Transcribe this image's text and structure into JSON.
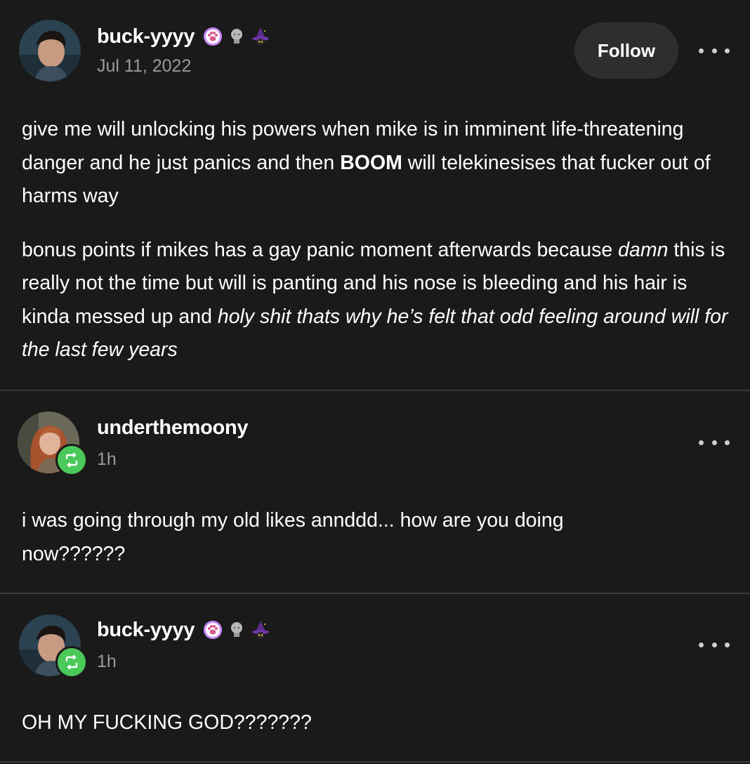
{
  "posts": [
    {
      "username": "buck-yyyy",
      "timestamp": "Jul 11, 2022",
      "follow_label": "Follow",
      "badges": [
        "paw-badge-icon",
        "statue-badge-icon",
        "witch-hat-badge-icon"
      ],
      "paragraphs": [
        {
          "a": "give me will unlocking his powers when mike is in imminent life-threatening danger and he just panics and then ",
          "b_bold": "BOOM",
          "c": " will telekinesises that fucker out of harms way"
        },
        {
          "a_italic": "damn",
          "pre": "bonus points if mikes has a gay panic moment afterwards because ",
          "mid": " this is really not the time but will is panting and his nose is bleeding and his hair is kinda messed up and ",
          "end_italic": "holy shit thats why he’s felt that odd feeling around will for the last few years"
        }
      ]
    },
    {
      "username": "underthemoony",
      "timestamp": "1h",
      "text": "i was going through my old likes annddd... how are you doing now??????"
    },
    {
      "username": "buck-yyyy",
      "timestamp": "1h",
      "badges": [
        "paw-badge-icon",
        "statue-badge-icon",
        "witch-hat-badge-icon"
      ],
      "text": "OH MY FUCKING GOD???????"
    }
  ],
  "colors": {
    "background": "#1a1a1a",
    "divider": "#3a3a3a",
    "follow_button": "#2e2e2e",
    "reblog_green": "#4bc95a",
    "timestamp_gray": "#9a9a9a",
    "paw_badge": "#c98bff"
  }
}
